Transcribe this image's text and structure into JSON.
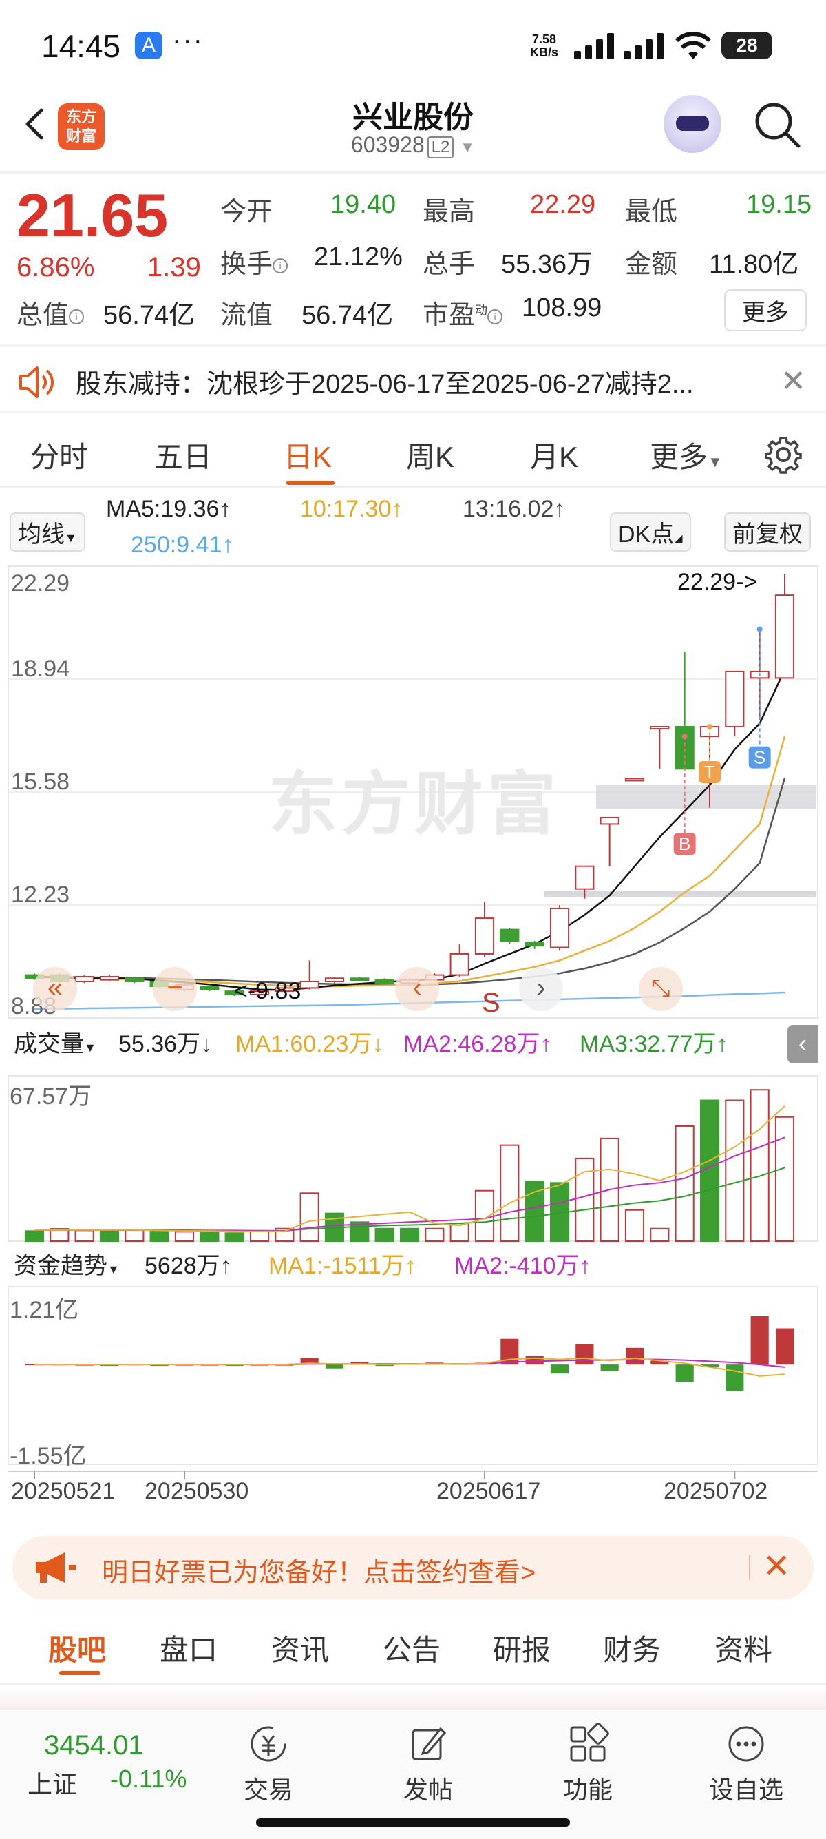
{
  "status_bar": {
    "time": "14:45",
    "app_icon": "app-store",
    "more": "···",
    "speed_value": "7.58",
    "speed_unit": "KB/s",
    "battery": "28"
  },
  "header": {
    "logo_line1": "东方",
    "logo_line2": "财富",
    "stock_name": "兴业股份",
    "stock_code": "603928",
    "level": "L2"
  },
  "quote": {
    "price": "21.65",
    "change_pct": "6.86%",
    "change": "1.39",
    "open_label": "今开",
    "open": "19.40",
    "high_label": "最高",
    "high": "22.29",
    "low_label": "最低",
    "low": "19.15",
    "turnover_label": "换手",
    "turnover": "21.12%",
    "volume_label": "总手",
    "volume": "55.36万",
    "amount_label": "金额",
    "amount": "11.80亿",
    "total_mv_label": "总值",
    "total_mv": "56.74亿",
    "float_mv_label": "流值",
    "float_mv": "56.74亿",
    "pe_label": "市盈",
    "pe_sup": "动",
    "pe": "108.99",
    "more_button": "更多"
  },
  "notice": {
    "text": "股东减持：沈根珍于2025-06-17至2025-06-27减持2..."
  },
  "tabs": [
    "分时",
    "五日",
    "日K",
    "周K",
    "月K",
    "更多"
  ],
  "active_tab": "日K",
  "chart": {
    "ma_select": "均线",
    "ma5": "MA5:19.36↑",
    "ma10": "10:17.30↑",
    "ma20": "13:16.02↑",
    "ma250": "250:9.41↑",
    "dk_button": "DK点",
    "fq_button": "前复权",
    "price_axis": [
      "22.29",
      "18.94",
      "15.58",
      "12.23",
      "8.88"
    ],
    "max_label": "22.29->",
    "min_label": "<-9.83",
    "watermark": "东方财富",
    "markers": [
      "S",
      "T",
      "B"
    ],
    "signal_s": "S",
    "volume_select": "成交量",
    "volume_value": "55.36万↓",
    "vol_ma1": "MA1:60.23万↓",
    "vol_ma2": "MA2:46.28万↑",
    "vol_ma3": "MA3:32.77万↑",
    "volume_axis_top": "67.57万",
    "fund_select": "资金趋势",
    "fund_value": "5628万↑",
    "fund_ma1": "MA1:-1511万↑",
    "fund_ma2": "MA2:-410万↑",
    "fund_axis_top": "1.21亿",
    "fund_axis_bottom": "-1.55亿",
    "dates": [
      "20250521",
      "20250530",
      "20250617",
      "20250702"
    ]
  },
  "chart_data": {
    "type": "candlestick",
    "candles": [
      {
        "o": 9.95,
        "c": 9.85,
        "h": 10.0,
        "l": 9.8
      },
      {
        "o": 9.95,
        "c": 9.75,
        "h": 10.0,
        "l": 9.7
      },
      {
        "o": 9.75,
        "c": 9.9,
        "h": 9.95,
        "l": 9.7
      },
      {
        "o": 9.8,
        "c": 9.9,
        "h": 9.95,
        "l": 9.75
      },
      {
        "o": 9.85,
        "c": 9.75,
        "h": 9.9,
        "l": 9.7
      },
      {
        "o": 9.75,
        "c": 9.6,
        "h": 9.8,
        "l": 9.55
      },
      {
        "o": 9.5,
        "c": 9.65,
        "h": 9.7,
        "l": 9.45
      },
      {
        "o": 9.6,
        "c": 9.5,
        "h": 9.65,
        "l": 9.45
      },
      {
        "o": 9.45,
        "c": 9.35,
        "h": 9.5,
        "l": 9.3
      },
      {
        "o": 9.35,
        "c": 9.45,
        "h": 9.5,
        "l": 9.3
      },
      {
        "o": 9.45,
        "c": 9.55,
        "h": 9.6,
        "l": 9.4
      },
      {
        "o": 9.55,
        "c": 9.75,
        "h": 10.4,
        "l": 9.5
      },
      {
        "o": 9.75,
        "c": 9.85,
        "h": 9.9,
        "l": 9.7
      },
      {
        "o": 9.85,
        "c": 9.8,
        "h": 9.9,
        "l": 9.75
      },
      {
        "o": 9.8,
        "c": 9.7,
        "h": 9.85,
        "l": 9.65
      },
      {
        "o": 9.7,
        "c": 9.8,
        "h": 9.85,
        "l": 9.65
      },
      {
        "o": 9.8,
        "c": 9.95,
        "h": 10.0,
        "l": 9.75
      },
      {
        "o": 9.95,
        "c": 10.6,
        "h": 10.9,
        "l": 9.9
      },
      {
        "o": 10.6,
        "c": 11.7,
        "h": 12.2,
        "l": 10.5
      },
      {
        "o": 11.35,
        "c": 11.0,
        "h": 11.4,
        "l": 10.9
      },
      {
        "o": 10.95,
        "c": 10.85,
        "h": 11.0,
        "l": 10.75
      },
      {
        "o": 10.8,
        "c": 12.0,
        "h": 12.1,
        "l": 10.7
      },
      {
        "o": 12.6,
        "c": 13.3,
        "h": 13.3,
        "l": 12.3
      },
      {
        "o": 14.6,
        "c": 14.8,
        "h": 14.8,
        "l": 13.3
      },
      {
        "o": 16.0,
        "c": 16.0,
        "h": 16.0,
        "l": 16.0
      },
      {
        "o": 17.6,
        "c": 17.6,
        "h": 17.6,
        "l": 16.3
      },
      {
        "o": 17.6,
        "c": 16.3,
        "h": 19.9,
        "l": 16.3
      },
      {
        "o": 17.3,
        "c": 17.6,
        "h": 17.6,
        "l": 15.1
      },
      {
        "o": 17.6,
        "c": 19.3,
        "h": 19.3,
        "l": 17.3
      },
      {
        "o": 19.1,
        "c": 19.3,
        "h": 20.6,
        "l": 17.8
      },
      {
        "o": 19.1,
        "c": 21.65,
        "h": 22.29,
        "l": 19.15
      }
    ],
    "ma5": [
      9.9,
      9.87,
      9.84,
      9.85,
      9.84,
      9.78,
      9.72,
      9.66,
      9.58,
      9.5,
      9.49,
      9.55,
      9.63,
      9.68,
      9.73,
      9.78,
      9.82,
      9.97,
      10.3,
      10.6,
      10.9,
      11.3,
      11.8,
      12.4,
      13.3,
      14.2,
      15.0,
      15.8,
      16.9,
      17.7,
      19.36
    ],
    "ma10": [
      9.85,
      9.84,
      9.84,
      9.83,
      9.82,
      9.8,
      9.77,
      9.73,
      9.69,
      9.65,
      9.62,
      9.6,
      9.6,
      9.62,
      9.63,
      9.65,
      9.69,
      9.76,
      9.9,
      10.05,
      10.2,
      10.4,
      10.7,
      11.0,
      11.4,
      11.9,
      12.5,
      13.0,
      13.8,
      14.6,
      17.3
    ],
    "ma20": [
      9.9,
      9.89,
      9.88,
      9.87,
      9.86,
      9.84,
      9.82,
      9.8,
      9.77,
      9.74,
      9.71,
      9.69,
      9.67,
      9.66,
      9.65,
      9.65,
      9.66,
      9.69,
      9.75,
      9.82,
      9.9,
      10.0,
      10.15,
      10.35,
      10.6,
      10.95,
      11.4,
      11.9,
      12.6,
      13.4,
      16.02
    ],
    "ma250": [
      8.9,
      8.91,
      8.92,
      8.93,
      8.94,
      8.95,
      8.96,
      8.97,
      8.98,
      8.99,
      9.0,
      9.01,
      9.02,
      9.04,
      9.06,
      9.08,
      9.1,
      9.12,
      9.14,
      9.16,
      9.18,
      9.2,
      9.22,
      9.24,
      9.26,
      9.28,
      9.3,
      9.33,
      9.36,
      9.38,
      9.41
    ],
    "price_range": [
      8.88,
      22.29
    ],
    "volume": [
      {
        "v": 4.5,
        "up": false
      },
      {
        "v": 5.5,
        "up": true
      },
      {
        "v": 4.8,
        "up": true
      },
      {
        "v": 4.7,
        "up": false
      },
      {
        "v": 4.9,
        "up": true
      },
      {
        "v": 4.5,
        "up": false
      },
      {
        "v": 4.2,
        "up": true
      },
      {
        "v": 4.5,
        "up": false
      },
      {
        "v": 3.6,
        "up": false
      },
      {
        "v": 4.4,
        "up": true
      },
      {
        "v": 5.6,
        "up": true
      },
      {
        "v": 21.4,
        "up": true
      },
      {
        "v": 12.4,
        "up": false
      },
      {
        "v": 8.5,
        "up": false
      },
      {
        "v": 5.6,
        "up": false
      },
      {
        "v": 5.6,
        "up": false
      },
      {
        "v": 5.6,
        "up": true
      },
      {
        "v": 7.9,
        "up": true
      },
      {
        "v": 22.5,
        "up": true
      },
      {
        "v": 42.8,
        "up": true
      },
      {
        "v": 26.5,
        "up": false
      },
      {
        "v": 26.0,
        "up": false
      },
      {
        "v": 36.9,
        "up": true
      },
      {
        "v": 45.8,
        "up": true
      },
      {
        "v": 13.9,
        "up": true
      },
      {
        "v": 5.6,
        "up": true
      },
      {
        "v": 51.3,
        "up": true
      },
      {
        "v": 62.8,
        "up": false
      },
      {
        "v": 62.8,
        "up": true
      },
      {
        "v": 67.5,
        "up": true
      },
      {
        "v": 55.36,
        "up": true
      }
    ],
    "vol_ma1": [
      5,
      5,
      5,
      5,
      5,
      4.8,
      4.6,
      4.5,
      4.4,
      4.3,
      4.4,
      9,
      10,
      11,
      12,
      13,
      8,
      7,
      10,
      17,
      22,
      25,
      31,
      32,
      30,
      27,
      31,
      36,
      42,
      50,
      60.23
    ],
    "vol_ma2": [
      5,
      5,
      5,
      5,
      5,
      4.9,
      4.8,
      4.7,
      4.6,
      4.5,
      4.5,
      6,
      7,
      7.5,
      8,
      8.5,
      9,
      9.5,
      10,
      13,
      15,
      17,
      20,
      23,
      25,
      26,
      28,
      33,
      38,
      42,
      46.28
    ],
    "vol_ma3": [
      5,
      5,
      5,
      5,
      5,
      5,
      4.9,
      4.8,
      4.8,
      4.7,
      4.7,
      5.5,
      6,
      6.5,
      7,
      7.2,
      7.5,
      8,
      8.5,
      10,
      11,
      12.5,
      14,
      15.5,
      17,
      18,
      20,
      23,
      26,
      29,
      32.77
    ],
    "volume_max": 67.57,
    "fund": [
      1,
      1,
      0.5,
      -0.5,
      1,
      -0.5,
      0.5,
      0.5,
      -0.5,
      0.5,
      0.5,
      10,
      -6,
      4,
      -2,
      2,
      3,
      2,
      3,
      40,
      13,
      -14,
      32,
      -10,
      26,
      6,
      -27,
      -4,
      -41,
      75,
      56.28
    ],
    "fund_ma1": [
      0,
      0,
      0,
      0,
      0,
      0,
      0,
      0,
      0,
      0,
      0,
      2,
      1,
      1,
      0,
      1,
      1,
      1,
      2,
      8,
      10,
      8,
      10,
      6,
      10,
      6,
      2,
      -4,
      -10,
      -18,
      -15.11
    ],
    "fund_ma2": [
      0,
      0,
      0,
      0,
      0,
      0,
      0,
      0,
      0,
      0,
      0,
      1,
      1,
      1,
      1,
      1,
      1,
      1,
      1,
      4,
      5,
      6,
      7,
      7,
      8,
      8,
      7,
      5,
      3,
      0,
      -4.1
    ],
    "fund_range": [
      -155,
      121
    ]
  },
  "promo": {
    "text": "明日好票已为您备好！点击签约查看>"
  },
  "bottom_tabs": [
    "股吧",
    "盘口",
    "资讯",
    "公告",
    "研报",
    "财务",
    "资料"
  ],
  "bottom_bar": {
    "index_value": "3454.01",
    "index_name": "上证",
    "index_change": "-0.11%",
    "nav": [
      "交易",
      "发帖",
      "功能",
      "设自选"
    ]
  }
}
